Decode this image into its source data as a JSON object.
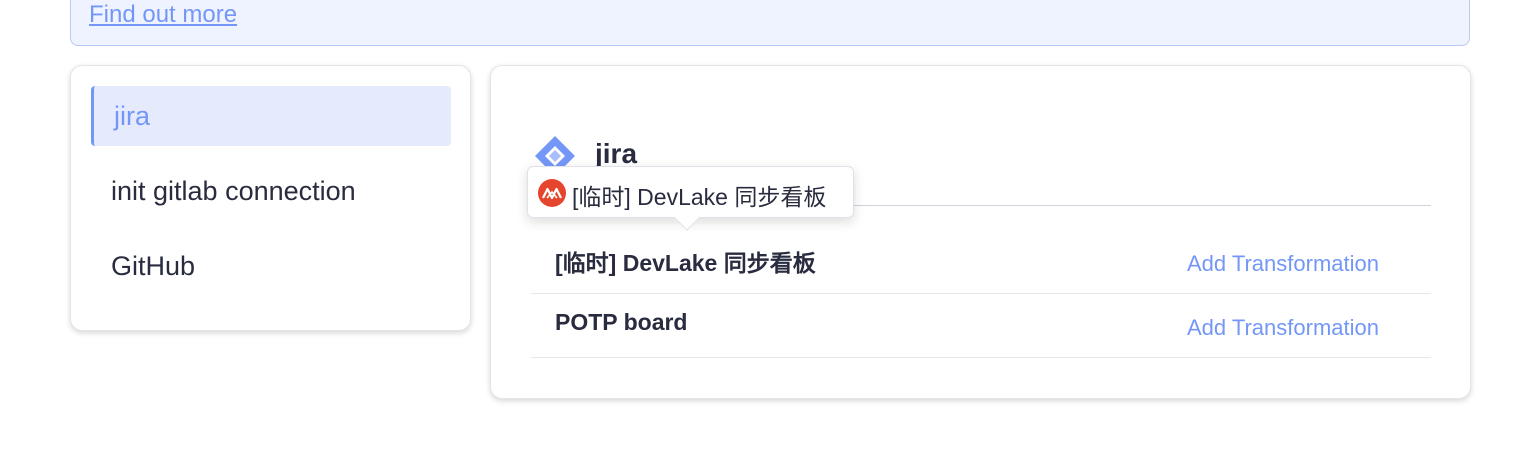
{
  "notice": {
    "link_label": "Find out more"
  },
  "connections": {
    "items": [
      {
        "label": "jira",
        "active": true
      },
      {
        "label": "init gitlab connection",
        "active": false
      },
      {
        "label": "GitHub",
        "active": false
      }
    ]
  },
  "scope": {
    "connection_title": "jira",
    "connection_icon": "jira-logo-icon",
    "rows": [
      {
        "name": "[临时] DevLake 同步看板",
        "action": "Add Transformation"
      },
      {
        "name": "POTP board",
        "action": "Add Transformation"
      }
    ]
  },
  "tooltip": {
    "icon": "board-avatar-icon",
    "text": "[临时] DevLake 同步看板"
  },
  "colors": {
    "accent": "#7497f7",
    "active_bg": "#e5ebfd",
    "notice_bg": "#eef3ff",
    "tooltip_icon": "#e5452c"
  }
}
